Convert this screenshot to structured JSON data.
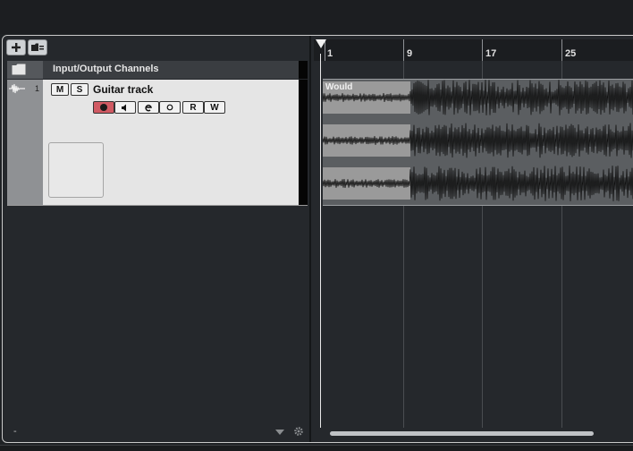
{
  "window": {
    "title": ""
  },
  "track_list": {
    "toolbar": {
      "add_track_icon": "plus-icon",
      "add_folder_icon": "folder-add-icon"
    },
    "io_channel": {
      "label": "Input/Output Channels",
      "icon": "folder-icon"
    },
    "tracks": [
      {
        "number": "1",
        "name": "Guitar track",
        "type_icon": "audio-waveform-icon",
        "mute_label": "M",
        "solo_label": "S",
        "read_label": "R",
        "write_label": "W",
        "record_enabled": true
      }
    ],
    "footer": {
      "left_text": "-"
    }
  },
  "ruler": {
    "bars": [
      "1",
      "9",
      "17",
      "25"
    ]
  },
  "events": [
    {
      "name": "Would",
      "track": 1
    }
  ],
  "colors": {
    "record_active": "#d05a63",
    "background": "#25282c",
    "track_bg": "#e5e5e5",
    "clip_bg": "#5b5e61"
  }
}
